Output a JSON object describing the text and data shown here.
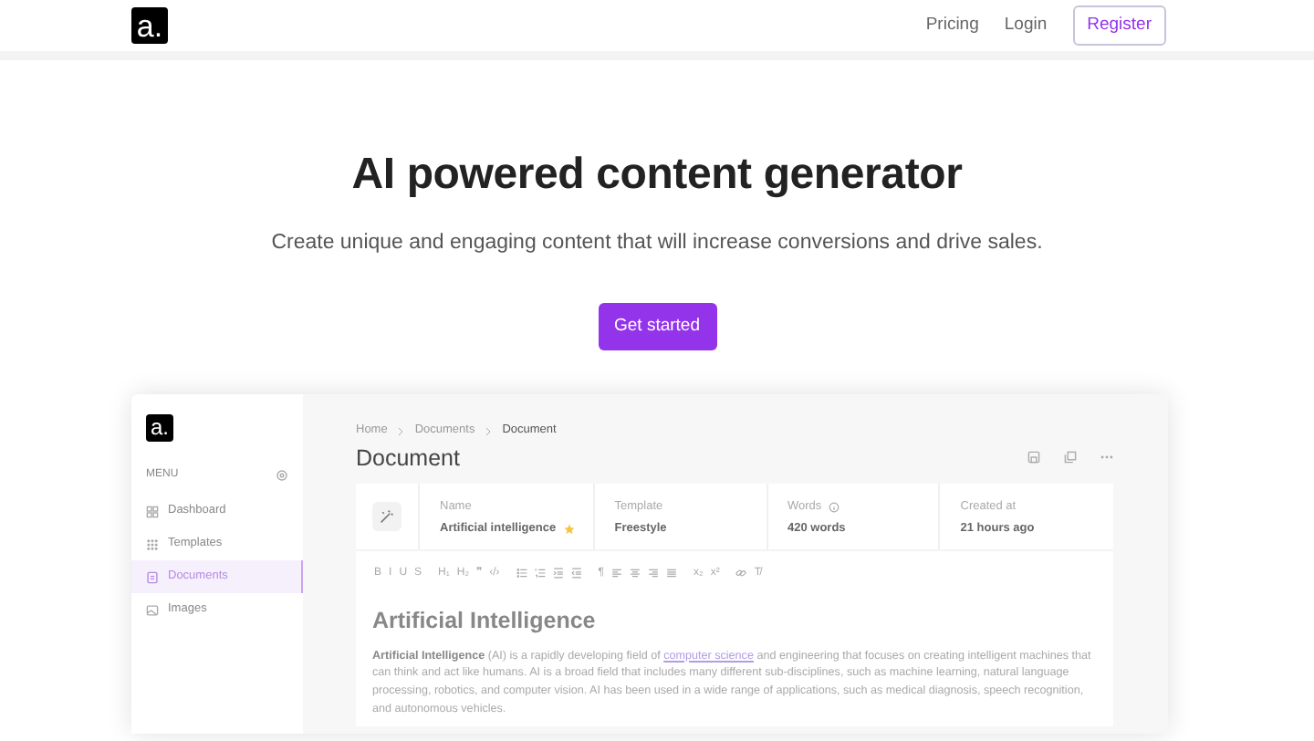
{
  "navbar": {
    "logo": "a.",
    "links": [
      {
        "label": "Pricing"
      },
      {
        "label": "Login"
      }
    ],
    "register": "Register"
  },
  "hero": {
    "title": "AI powered content generator",
    "subtitle": "Create unique and engaging content that will increase conversions and drive sales.",
    "cta": "Get started"
  },
  "app": {
    "sidebar": {
      "logo": "a.",
      "menu_label": "MENU",
      "items": [
        {
          "label": "Dashboard",
          "kind": "dashboard",
          "selected": false
        },
        {
          "label": "Templates",
          "kind": "templates",
          "selected": false
        },
        {
          "label": "Documents",
          "kind": "documents",
          "selected": true
        },
        {
          "label": "Images",
          "kind": "images",
          "selected": false
        }
      ]
    },
    "breadcrumb": [
      "Home",
      "Documents",
      "Document"
    ],
    "title": "Document",
    "info": [
      {
        "label": "Name",
        "value": "Artificial intelligence",
        "starred": true,
        "info_icon": false
      },
      {
        "label": "Template",
        "value": "Freestyle",
        "starred": false,
        "info_icon": false
      },
      {
        "label": "Words",
        "value": "420 words",
        "starred": false,
        "info_icon": true
      },
      {
        "label": "Created at",
        "value": "21 hours ago",
        "starred": false,
        "info_icon": false
      }
    ],
    "toolbar": [
      [
        {
          "kind": "text",
          "label": "B"
        },
        {
          "kind": "text",
          "label": "I"
        },
        {
          "kind": "text",
          "label": "U"
        },
        {
          "kind": "text",
          "label": "S"
        }
      ],
      [
        {
          "kind": "text",
          "label": "H₁"
        },
        {
          "kind": "text",
          "label": "H₂"
        },
        {
          "kind": "text",
          "label": "❞"
        },
        {
          "kind": "text",
          "label": "‹/›"
        }
      ],
      [
        {
          "kind": "bullets"
        },
        {
          "kind": "numbers"
        },
        {
          "kind": "indent"
        },
        {
          "kind": "outdent"
        }
      ],
      [
        {
          "kind": "text",
          "label": "¶"
        },
        {
          "kind": "align-left"
        },
        {
          "kind": "align-center"
        },
        {
          "kind": "align-right"
        },
        {
          "kind": "justify"
        }
      ],
      [
        {
          "kind": "text",
          "label": "x₂"
        },
        {
          "kind": "text",
          "label": "x²"
        }
      ],
      [
        {
          "kind": "link"
        },
        {
          "kind": "text",
          "label": "T̸"
        }
      ]
    ],
    "heading": "Artificial Intelligence",
    "paragraph": {
      "before": "**Artificial Intelligence** (AI) is a rapidly developing field of",
      "link": "computer science",
      "after": "and engineering that focuses on creating intelligent machines that can think and act like humans. AI is a broad field that includes many different sub-disciplines, such as machine learning, natural language processing, robotics, and computer vision. AI has been used in a wide range of applications, such as medical diagnosis, speech recognition, and autonomous vehicles."
    }
  }
}
